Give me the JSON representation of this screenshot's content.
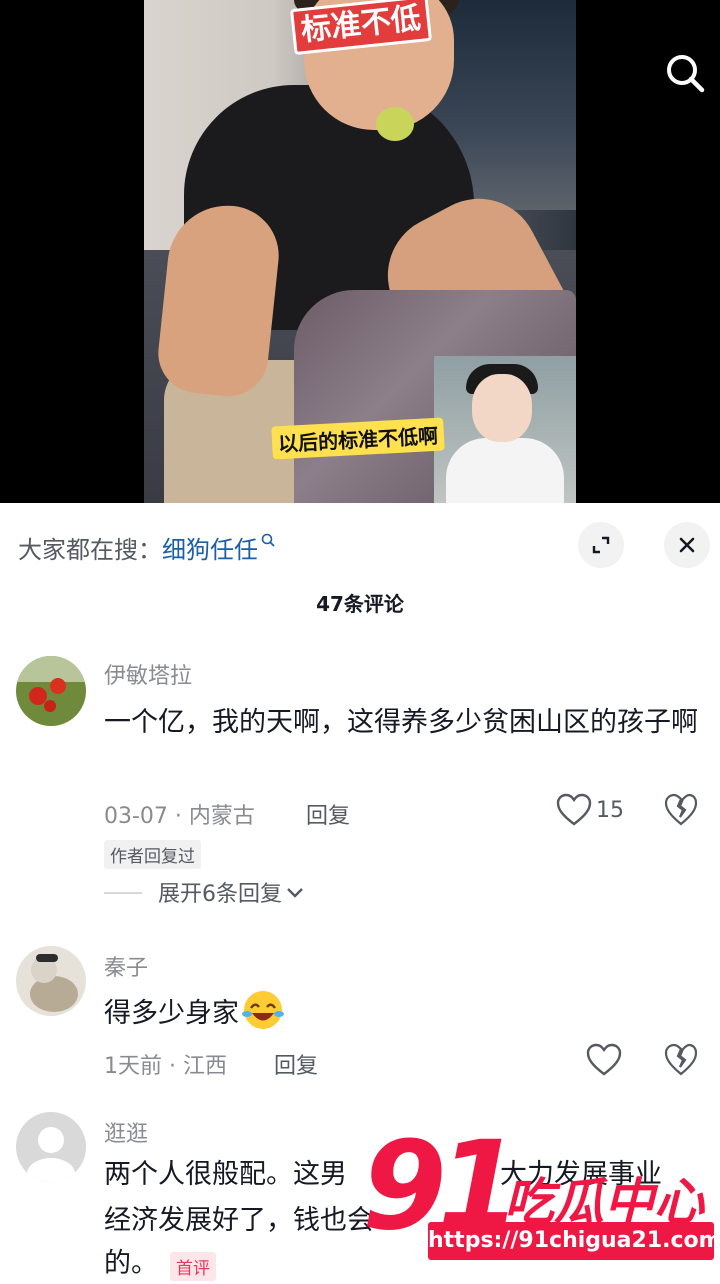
{
  "video": {
    "caption_top": "标准不低",
    "caption_sub": "以后的标准不低啊"
  },
  "hot_search": {
    "prefix": "大家都在搜：",
    "term": "细狗任任"
  },
  "comments_header": {
    "count_label": "47条评论"
  },
  "comments": [
    {
      "username": "伊敏塔拉",
      "text": "一个亿，我的天啊，这得养多少贫困山区的孩子啊",
      "meta": "03-07 · 内蒙古",
      "reply_label": "回复",
      "likes": "15",
      "tag": "作者回复过",
      "expand_label": "展开6条回复"
    },
    {
      "username": "秦子",
      "text": "得多少身家",
      "meta": "1天前 · 江西",
      "reply_label": "回复"
    },
    {
      "username": "逛逛",
      "text_line1": "两个人很般配。这男",
      "text_line1_end": "大力发展事业",
      "text_line2": "经济发展好了，钱也会",
      "text_line3": "的。",
      "tag": "首评"
    }
  ],
  "watermark": {
    "number": "91",
    "name": "吃瓜中心",
    "url": "https://91chigua21.com"
  },
  "colors": {
    "accent_link": "#1b5fa8",
    "watermark_red": "#ef1844"
  },
  "icons": [
    "search-icon",
    "expand-icon",
    "close-icon",
    "heart-icon",
    "dislike-icon",
    "chevron-down-icon",
    "laugh-cry-emoji"
  ]
}
